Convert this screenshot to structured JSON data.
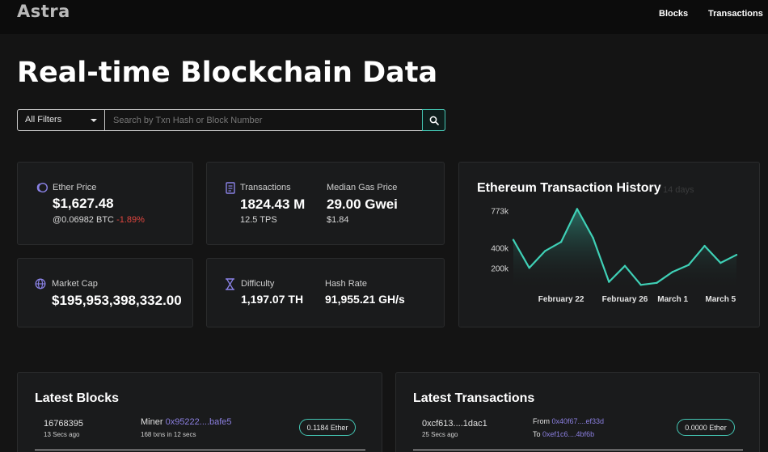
{
  "nav": {
    "logo": "Astra",
    "links": [
      "Blocks",
      "Transactions"
    ]
  },
  "hero": {
    "title": "Real-time Blockchain Data"
  },
  "search": {
    "filter_selected": "All Filters",
    "placeholder": "Search by Txn Hash or Block Number"
  },
  "stats": {
    "ether_price": {
      "label": "Ether Price",
      "value": "$1,627.48",
      "btc": "@0.06982 BTC",
      "change": "-1.89%"
    },
    "transactions": {
      "label": "Transactions",
      "value": "1824.43 M",
      "sub": "12.5 TPS"
    },
    "median_gas": {
      "label": "Median Gas Price",
      "value": "29.00 Gwei",
      "sub": "$1.84"
    },
    "market_cap": {
      "label": "Market Cap",
      "value": "$195,953,398,332.00"
    },
    "difficulty": {
      "label": "Difficulty",
      "value": "1,197.07 TH"
    },
    "hash_rate": {
      "label": "Hash Rate",
      "value": "91,955.21 GH/s"
    }
  },
  "chart_data": {
    "type": "area",
    "title": "Ethereum Transaction History",
    "subtitle": "14 days",
    "x_tick_labels": [
      "February 22",
      "February 26",
      "March 1",
      "March 5"
    ],
    "y_tick_labels": [
      "773k",
      "400k",
      "200k"
    ],
    "y_ticks": [
      773000,
      400000,
      200000
    ],
    "values": [
      480000,
      200000,
      370000,
      460000,
      790000,
      500000,
      60000,
      220000,
      30000,
      50000,
      160000,
      230000,
      420000,
      250000,
      330000
    ],
    "ylim": [
      0,
      850000
    ],
    "line_color": "#3fd0b6",
    "grid": false
  },
  "latest_blocks": {
    "title": "Latest Blocks",
    "rows": [
      {
        "block": "16768395",
        "age": "13 Secs ago",
        "miner_label": "Miner",
        "miner": "0x95222....bafe5",
        "txns": "168 txns in 12 secs",
        "reward": "0.1184 Ether"
      }
    ]
  },
  "latest_transactions": {
    "title": "Latest Transactions",
    "rows": [
      {
        "hash": "0xcf613....1dac1",
        "age": "25 Secs ago",
        "from_label": "From",
        "from": "0x40f67....ef33d",
        "to_label": "To",
        "to": "0xef1c6....4bf6b",
        "value": "0.0000 Ether"
      }
    ]
  },
  "colors": {
    "accent": "#44c7b4",
    "link": "#8b7fe0",
    "negative": "#e0463f",
    "icon": "#8a82e6"
  }
}
